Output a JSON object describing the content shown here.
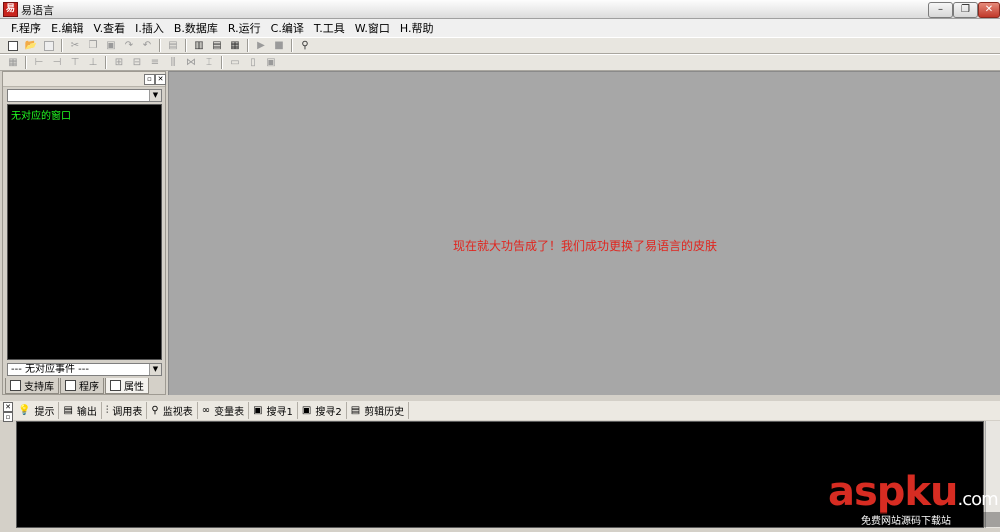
{
  "window": {
    "title": "易语言",
    "app_icon_glyph": "易",
    "controls": {
      "minimize": "–",
      "maximize": "❐",
      "close": "✕"
    }
  },
  "menu": [
    {
      "label": "F.程序"
    },
    {
      "label": "E.编辑"
    },
    {
      "label": "V.查看"
    },
    {
      "label": "I.插入"
    },
    {
      "label": "B.数据库"
    },
    {
      "label": "R.运行"
    },
    {
      "label": "C.编译"
    },
    {
      "label": "T.工具"
    },
    {
      "label": "W.窗口"
    },
    {
      "label": "H.帮助"
    }
  ],
  "left_panel": {
    "top_combo_value": "",
    "tree_text": "无对应的窗口",
    "event_combo_value": "--- 无对应事件 ---",
    "tabs": [
      {
        "label": "支持库"
      },
      {
        "label": "程序"
      },
      {
        "label": "属性"
      }
    ]
  },
  "main": {
    "message": "现在就大功告成了！我们成功更换了易语言的皮肤"
  },
  "bottom_tabs": [
    {
      "label": "提示",
      "icon": "lightbulb-icon"
    },
    {
      "label": "输出",
      "icon": "output-icon"
    },
    {
      "label": "调用表",
      "icon": "call-table-icon"
    },
    {
      "label": "监视表",
      "icon": "magnifier-icon"
    },
    {
      "label": "变量表",
      "icon": "variable-icon"
    },
    {
      "label": "搜寻1",
      "icon": "search1-icon"
    },
    {
      "label": "搜寻2",
      "icon": "search2-icon"
    },
    {
      "label": "剪辑历史",
      "icon": "clip-history-icon"
    }
  ],
  "watermark": {
    "brand": "aspku",
    "tld": ".com",
    "subtitle": "免费网站源码下载站"
  },
  "colors": {
    "main_bg": "#a7a7a7",
    "message": "#e0261f",
    "tree_text": "#22ff22",
    "watermark_red": "#d72c22"
  }
}
